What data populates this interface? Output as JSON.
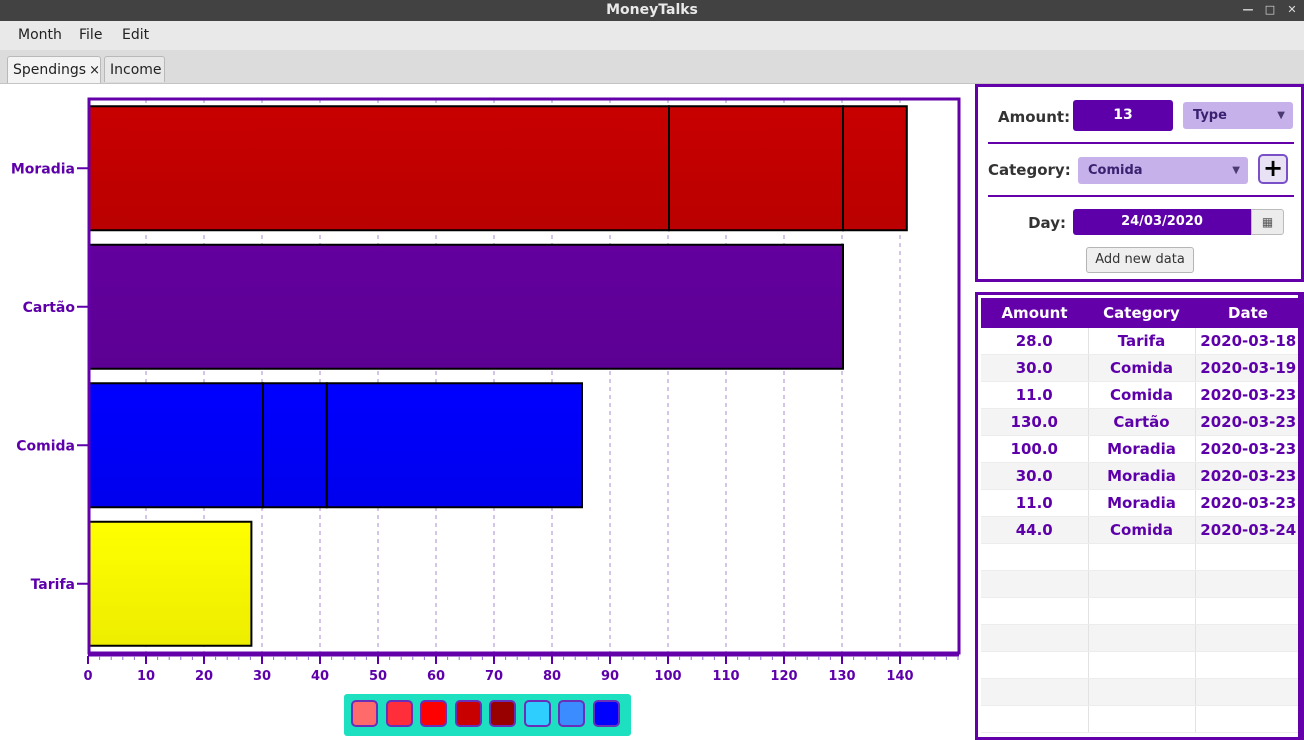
{
  "window": {
    "title": "MoneyTalks"
  },
  "menu": {
    "items": [
      "Month",
      "File",
      "Edit"
    ]
  },
  "tabs": [
    {
      "label": "Spendings",
      "close": "×",
      "active": true
    },
    {
      "label": "Income",
      "active": false
    }
  ],
  "form": {
    "amount_label": "Amount:",
    "amount_value": "13",
    "type_placeholder": "Type",
    "category_label": "Category:",
    "category_value": "Comida",
    "add_category_symbol": "+",
    "day_label": "Day:",
    "day_value": "24/03/2020",
    "add_button": "Add new data"
  },
  "table": {
    "headers": [
      "Amount",
      "Category",
      "Date"
    ],
    "rows": [
      [
        "28.0",
        "Tarifa",
        "2020-03-18"
      ],
      [
        "30.0",
        "Comida",
        "2020-03-19"
      ],
      [
        "11.0",
        "Comida",
        "2020-03-23"
      ],
      [
        "130.0",
        "Cartão",
        "2020-03-23"
      ],
      [
        "100.0",
        "Moradia",
        "2020-03-23"
      ],
      [
        "30.0",
        "Moradia",
        "2020-03-23"
      ],
      [
        "11.0",
        "Moradia",
        "2020-03-23"
      ],
      [
        "44.0",
        "Comida",
        "2020-03-24"
      ]
    ],
    "empty_rows": 7
  },
  "chart_data": {
    "type": "bar",
    "orientation": "horizontal",
    "stacked": true,
    "categories": [
      "Moradia",
      "Cartão",
      "Comida",
      "Tarifa"
    ],
    "stacks": [
      {
        "category": "Moradia",
        "segments": [
          100,
          30,
          11
        ],
        "color": "#c80000"
      },
      {
        "category": "Cartão",
        "segments": [
          130
        ],
        "color": "#63009e"
      },
      {
        "category": "Comida",
        "segments": [
          30,
          11,
          44
        ],
        "color": "#0000ff"
      },
      {
        "category": "Tarifa",
        "segments": [
          28
        ],
        "color": "#ffff00"
      }
    ],
    "x_ticks": [
      0,
      10,
      20,
      30,
      40,
      50,
      60,
      70,
      80,
      90,
      100,
      110,
      120,
      130,
      140
    ],
    "xlim": [
      0,
      150
    ],
    "grid": "vertical dashed",
    "title": "",
    "xlabel": "",
    "ylabel": ""
  },
  "palette": [
    "#ff6b6b",
    "#ff2e3a",
    "#ff0000",
    "#c80000",
    "#980000",
    "#2ecfff",
    "#3b8cff",
    "#0000ff"
  ],
  "colors": {
    "accent": "#6300aa",
    "accent_light": "#c7b1ea",
    "legend_bg": "#1de0c0"
  }
}
